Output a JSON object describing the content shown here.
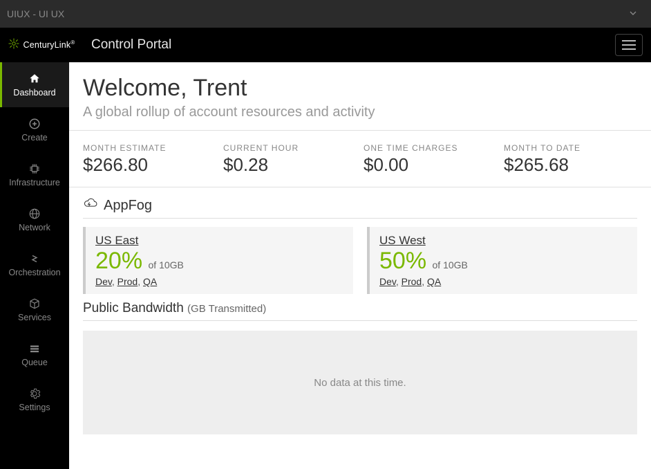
{
  "accountBar": {
    "label": "UIUX - UI UX"
  },
  "header": {
    "brand": "CenturyLink",
    "portal": "Control Portal"
  },
  "sidebar": {
    "items": [
      {
        "label": "Dashboard"
      },
      {
        "label": "Create"
      },
      {
        "label": "Infrastructure"
      },
      {
        "label": "Network"
      },
      {
        "label": "Orchestration"
      },
      {
        "label": "Services"
      },
      {
        "label": "Queue"
      },
      {
        "label": "Settings"
      }
    ]
  },
  "welcome": {
    "title": "Welcome, Trent",
    "subtitle": "A global rollup of account resources and activity"
  },
  "stats": [
    {
      "label": "MONTH ESTIMATE",
      "value": "$266.80"
    },
    {
      "label": "CURRENT HOUR",
      "value": "$0.28"
    },
    {
      "label": "ONE TIME CHARGES",
      "value": "$0.00"
    },
    {
      "label": "MONTH TO DATE",
      "value": "$265.68"
    }
  ],
  "appfog": {
    "title": "AppFog",
    "regions": [
      {
        "name": "US East",
        "percent": "20%",
        "of": "of 10GB",
        "envs": [
          "Dev",
          "Prod",
          "QA"
        ]
      },
      {
        "name": "US West",
        "percent": "50%",
        "of": "of 10GB",
        "envs": [
          "Dev",
          "Prod",
          "QA"
        ]
      }
    ]
  },
  "bandwidth": {
    "title": "Public Bandwidth",
    "unit": "(GB Transmitted)",
    "nodata": "No data at this time."
  }
}
